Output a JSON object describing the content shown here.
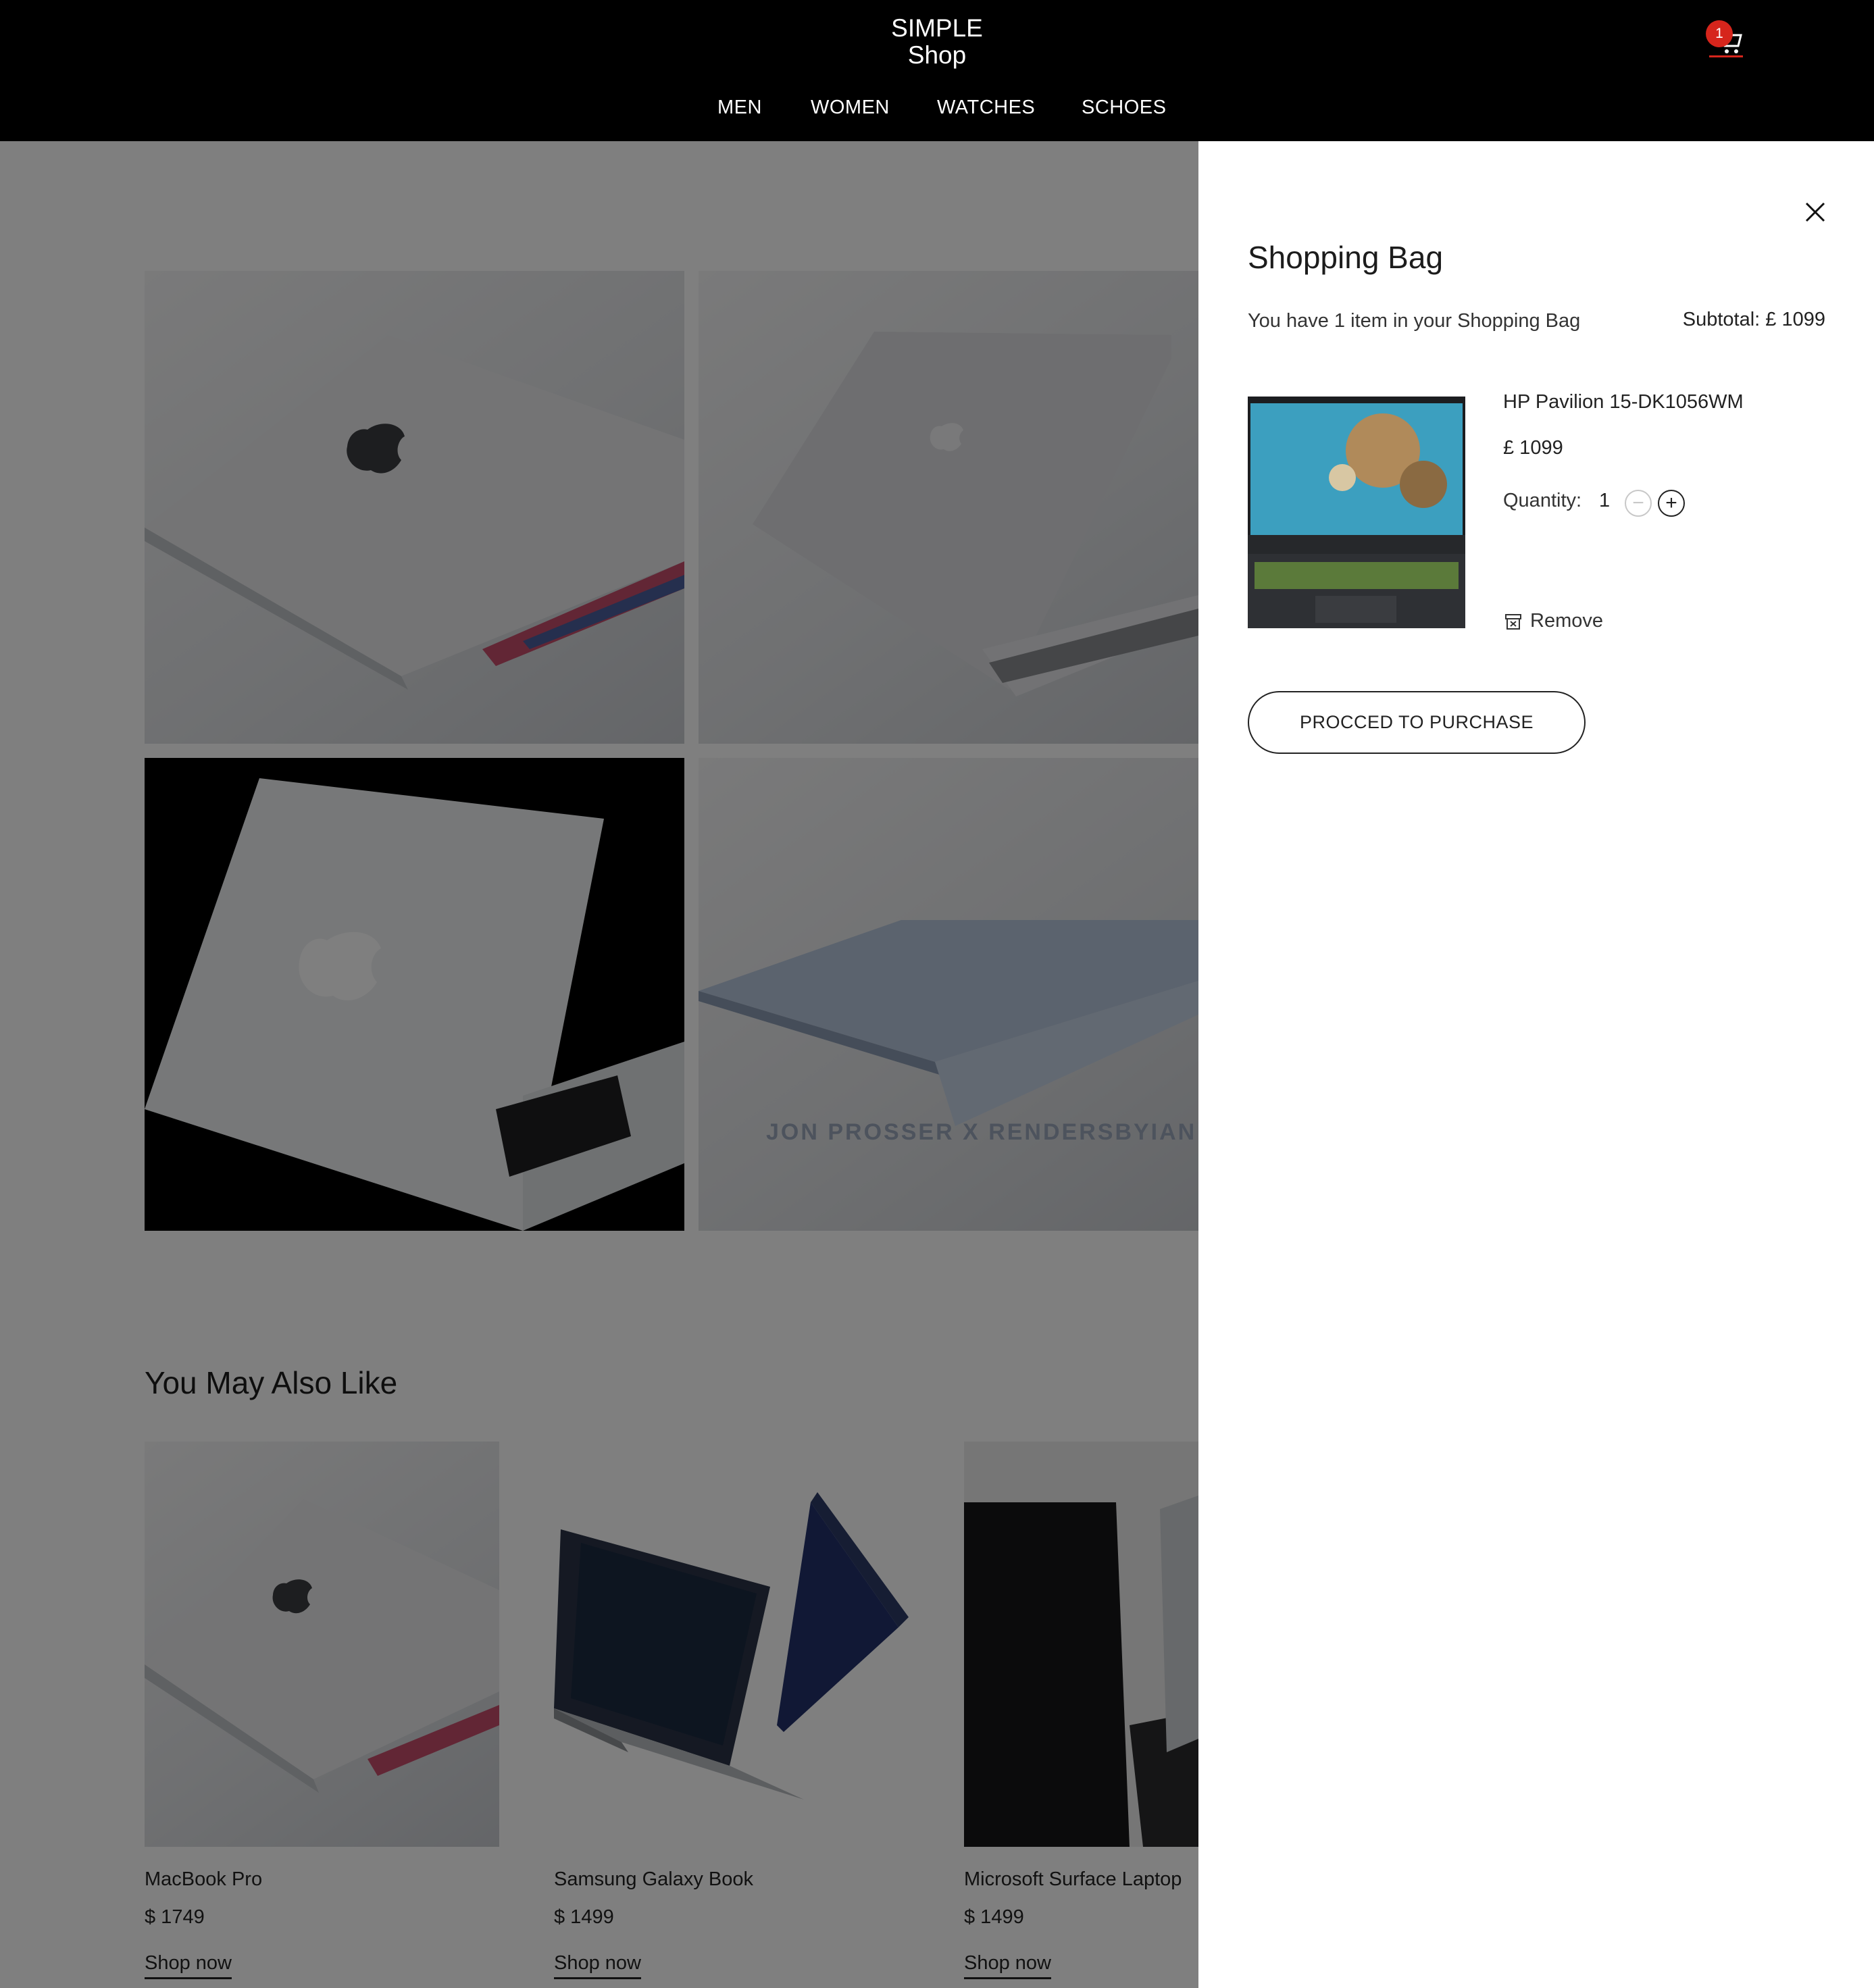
{
  "header": {
    "logo_line1": "SIMPLE",
    "logo_line2": "Shop",
    "nav": [
      "MEN",
      "WOMEN",
      "WATCHES",
      "SCHOES"
    ],
    "cart_count": "1",
    "cart_icon": "cart-icon",
    "colors": {
      "background": "#000000",
      "badge": "#d6251c",
      "text": "#ffffff"
    }
  },
  "product_gallery": {
    "images": [
      "macbook-angle-1",
      "macbook-angle-2",
      "macbook-on-black",
      "macbook-side-profile"
    ],
    "watermark_text": "JON PROSSER X RENDERSBYIAN"
  },
  "recommendations": {
    "title": "You May Also Like",
    "items": [
      {
        "name": "MacBook Pro",
        "price": "$ 1749",
        "link": "Shop now"
      },
      {
        "name": "Samsung Galaxy Book",
        "price": "$ 1499",
        "link": "Shop now"
      },
      {
        "name": "Microsoft Surface Laptop",
        "price": "$ 1499",
        "link": "Shop now"
      }
    ]
  },
  "bag": {
    "title": "Shopping Bag",
    "count_text": "You have 1 item in your Shopping Bag",
    "subtotal": "Subtotal: £ 1099",
    "item": {
      "name": "HP Pavilion 15-DK1056WM",
      "price": "£ 1099",
      "quantity_label": "Quantity:",
      "quantity": "1",
      "minus": "−",
      "plus": "+",
      "remove_label": "Remove"
    },
    "purchase_label": "PROCCED TO PURCHASE",
    "close_icon": "close-icon"
  }
}
